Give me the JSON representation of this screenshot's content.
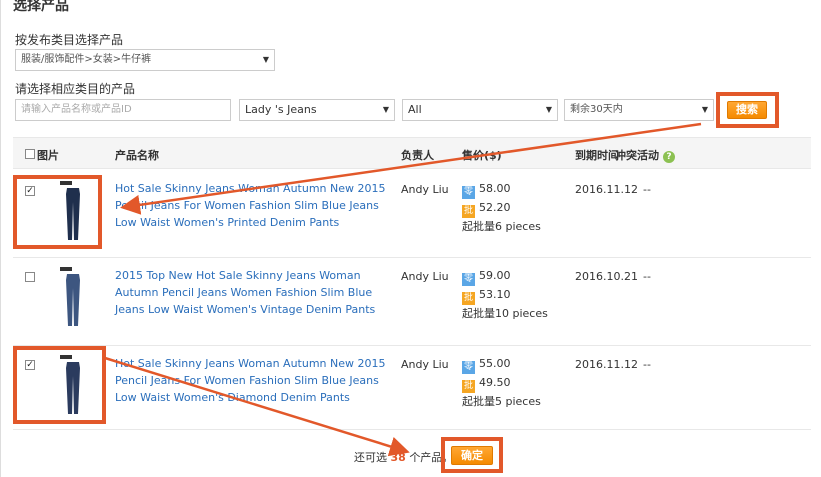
{
  "header": {
    "title": "选择产品"
  },
  "category": {
    "label": "按发布类目选择产品",
    "selected": "服装/服饰配件>女装>牛仔裤"
  },
  "filters": {
    "label": "请选择相应类目的产品",
    "search_placeholder": "请输入产品名称或产品ID",
    "owner_selected": "Lady 's Jeans",
    "group_selected": "All",
    "expiry_selected": "剩余30天内",
    "search_button": "搜索"
  },
  "table": {
    "headers": {
      "image": "图片",
      "name": "产品名称",
      "owner": "负责人",
      "price": "售价($)",
      "expiry": "到期时间",
      "conflict": "冲突活动"
    },
    "rows": [
      {
        "checked": true,
        "name": "Hot Sale Skinny Jeans Woman Autumn New 2015 Pencil Jeans For Women Fashion Slim Blue Jeans Low Waist Women's Printed Denim Pants",
        "owner": "Andy Liu",
        "retail_tag": "零",
        "retail_price": "58.00",
        "wholesale_tag": "批",
        "wholesale_price": "52.20",
        "min_batch": "起批量6 pieces",
        "expiry": "2016.11.12",
        "conflict": "--"
      },
      {
        "checked": false,
        "name": "2015 Top New Hot Sale Skinny Jeans Woman Autumn Pencil Jeans Women Fashion Slim Blue Jeans Low Waist Women's Vintage Denim Pants",
        "owner": "Andy Liu",
        "retail_tag": "零",
        "retail_price": "59.00",
        "wholesale_tag": "批",
        "wholesale_price": "53.10",
        "min_batch": "起批量10 pieces",
        "expiry": "2016.10.21",
        "conflict": "--"
      },
      {
        "checked": true,
        "name": "Hot Sale Skinny Jeans Woman Autumn New 2015 Pencil Jeans For Women Fashion Slim Blue Jeans Low Waist Women's Diamond Denim Pants",
        "owner": "Andy Liu",
        "retail_tag": "零",
        "retail_price": "55.00",
        "wholesale_tag": "批",
        "wholesale_price": "49.50",
        "min_batch": "起批量5 pieces",
        "expiry": "2016.11.12",
        "conflict": "--"
      }
    ]
  },
  "footer": {
    "prefix": "还可选",
    "remaining": "38",
    "suffix": "个产品。",
    "confirm_button": "确定"
  },
  "colors": {
    "accent_orange": "#f58a00",
    "highlight": "#e2582a",
    "link_blue": "#2a6ebb"
  }
}
